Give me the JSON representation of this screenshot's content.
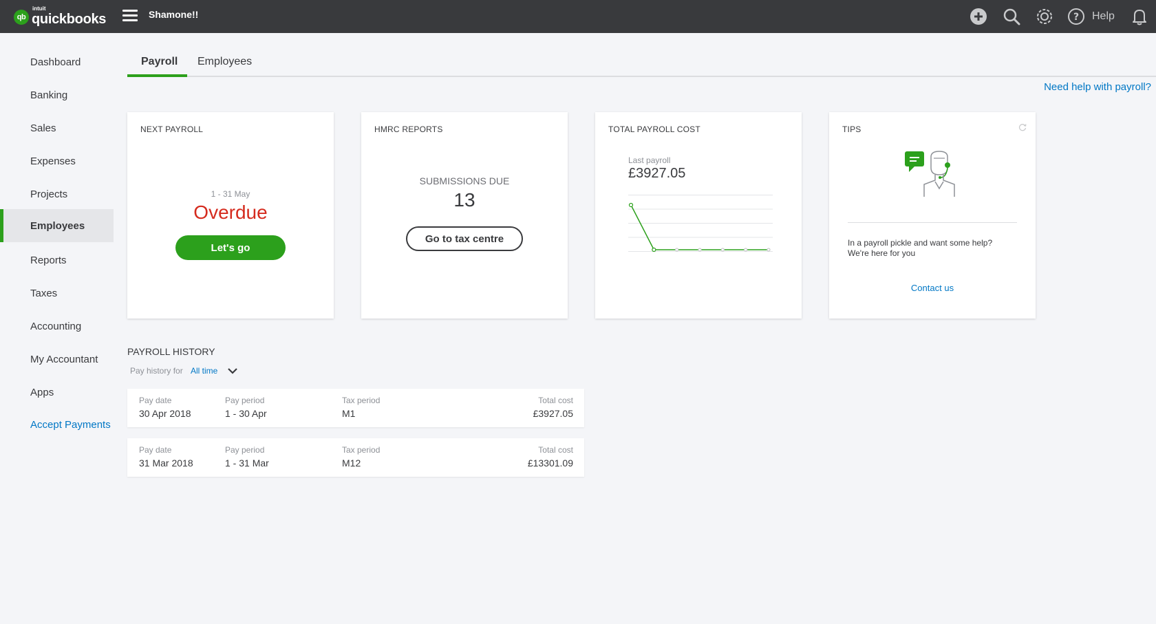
{
  "header": {
    "logo_badge": "qb",
    "logo_brand": "intuit",
    "logo_name": "quickbooks",
    "company_name": "Shamone!!",
    "help_label": "Help",
    "icons": [
      "plus-circle-icon",
      "search-icon",
      "gear-icon",
      "help-circle-icon",
      "bell-icon"
    ]
  },
  "sidebar": {
    "items": [
      {
        "label": "Dashboard"
      },
      {
        "label": "Banking"
      },
      {
        "label": "Sales"
      },
      {
        "label": "Expenses"
      },
      {
        "label": "Projects"
      },
      {
        "label": "Employees"
      },
      {
        "label": "Reports"
      },
      {
        "label": "Taxes"
      },
      {
        "label": "Accounting"
      },
      {
        "label": "My Accountant"
      },
      {
        "label": "Apps"
      },
      {
        "label": "Accept Payments"
      }
    ],
    "active": "Employees"
  },
  "tabs": [
    {
      "label": "Payroll"
    },
    {
      "label": "Employees"
    }
  ],
  "help_link": "Need help with payroll?",
  "cards": {
    "next_payroll": {
      "title": "NEXT PAYROLL",
      "period": "1 - 31 May",
      "status": "Overdue",
      "button": "Let's go"
    },
    "hmrc": {
      "title": "HMRC REPORTS",
      "subtitle": "SUBMISSIONS DUE",
      "count": "13",
      "button": "Go to tax centre"
    },
    "total_cost": {
      "title": "TOTAL PAYROLL COST",
      "caption": "Last payroll",
      "amount": "£3927.05"
    },
    "tips": {
      "title": "TIPS",
      "text_line1": "In a payroll pickle and want some help?",
      "text_line2": "We're here for you",
      "link": "Contact us"
    }
  },
  "chart_data": {
    "type": "line",
    "series": [
      {
        "values": [
          100,
          0,
          0,
          0,
          0,
          0,
          0
        ]
      }
    ],
    "ylim": [
      0,
      100
    ]
  },
  "payroll_history": {
    "title": "PAYROLL HISTORY",
    "filter_label": "Pay history for",
    "filter_value": "All time",
    "columns": {
      "pay_date": "Pay date",
      "pay_period": "Pay period",
      "tax_period": "Tax period",
      "total_cost": "Total cost"
    },
    "rows": [
      {
        "pay_date": "30 Apr 2018",
        "pay_period": "1 - 30 Apr",
        "tax_period": "M1",
        "total_cost": "£3927.05"
      },
      {
        "pay_date": "31 Mar 2018",
        "pay_period": "1 - 31 Mar",
        "tax_period": "M12",
        "total_cost": "£13301.09"
      }
    ]
  },
  "colors": {
    "topbar": "#393a3d",
    "accent_green": "#2ca01c",
    "link_blue": "#0077c5",
    "overdue_red": "#d52b1e"
  }
}
